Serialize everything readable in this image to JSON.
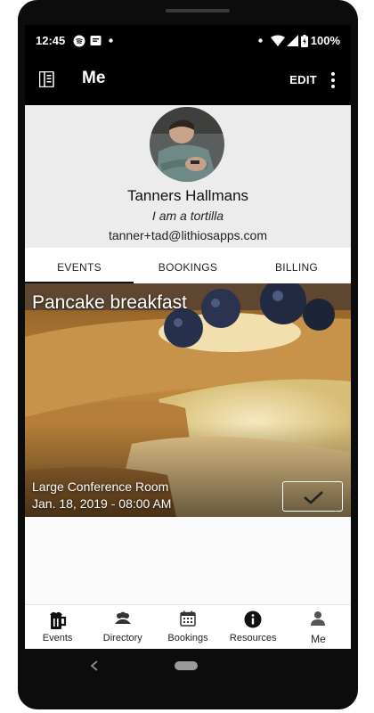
{
  "status_bar": {
    "time": "12:45",
    "battery": "100%"
  },
  "app_bar": {
    "title": "Me",
    "edit_label": "EDIT"
  },
  "profile": {
    "name": "Tanners Hallmans",
    "tagline": "I am a tortilla",
    "email": "tanner+tad@lithiosapps.com"
  },
  "tabs": [
    {
      "label": "EVENTS",
      "active": true
    },
    {
      "label": "BOOKINGS",
      "active": false
    },
    {
      "label": "BILLING",
      "active": false
    }
  ],
  "event": {
    "title": "Pancake breakfast",
    "location": "Large Conference Room",
    "datetime": "Jan. 18, 2019 - 08:00 AM"
  },
  "bottom_nav": [
    {
      "label": "Events",
      "icon": "beer-mug-icon"
    },
    {
      "label": "Directory",
      "icon": "people-icon"
    },
    {
      "label": "Bookings",
      "icon": "calendar-icon"
    },
    {
      "label": "Resources",
      "icon": "info-icon"
    },
    {
      "label": "Me",
      "icon": "person-icon",
      "active": true
    }
  ],
  "colors": {
    "app_bar": "#000000",
    "profile_bg": "#ececec",
    "accent": "#111111"
  }
}
